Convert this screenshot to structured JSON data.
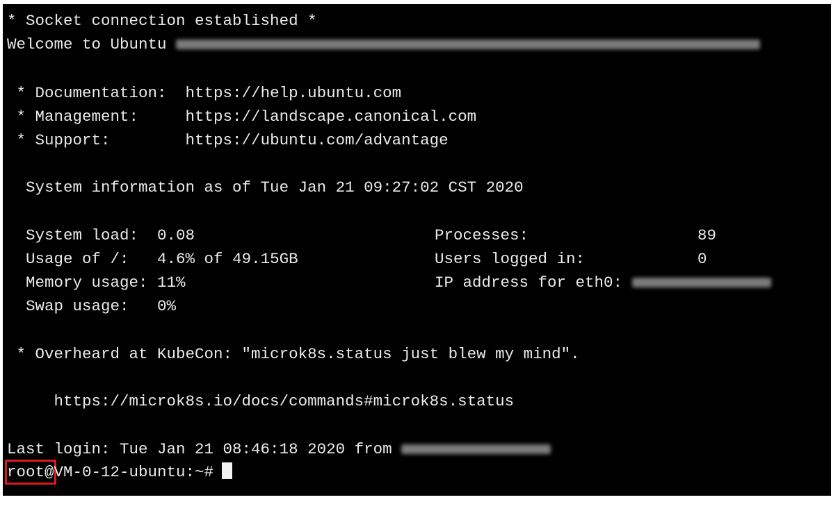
{
  "terminal": {
    "banner": "* Socket connection established *",
    "welcome": "Welcome to Ubuntu ",
    "docs_label": " * Documentation:  ",
    "docs_url": "https://help.ubuntu.com",
    "mgmt_label": " * Management:     ",
    "mgmt_url": "https://landscape.canonical.com",
    "support_label": " * Support:        ",
    "support_url": "https://ubuntu.com/advantage",
    "sysinfo": "  System information as of Tue Jan 21 09:27:02 CST 2020",
    "stats": {
      "load_label": "  System load:  ",
      "load_value": "0.08",
      "processes_label": "Processes:",
      "processes_value": "89",
      "usage_label": "  Usage of /:   ",
      "usage_value": "4.6% of 49.15GB",
      "users_label": "Users logged in:",
      "users_value": "0",
      "memory_label": "  Memory usage: ",
      "memory_value": "11%",
      "ip_label": "IP address for eth0:",
      "swap_label": "  Swap usage:   ",
      "swap_value": "0%"
    },
    "overheard": " * Overheard at KubeCon: \"microk8s.status just blew my mind\".",
    "docs_link": "     https://microk8s.io/docs/commands#microk8s.status",
    "last_login": "Last login: Tue Jan 21 08:46:18 2020 from ",
    "prompt_user": "root@",
    "prompt_host": "VM-0-12-ubuntu:~#"
  },
  "colors": {
    "background": "#000000",
    "text": "#ebebeb",
    "highlight": "#e0191d"
  }
}
